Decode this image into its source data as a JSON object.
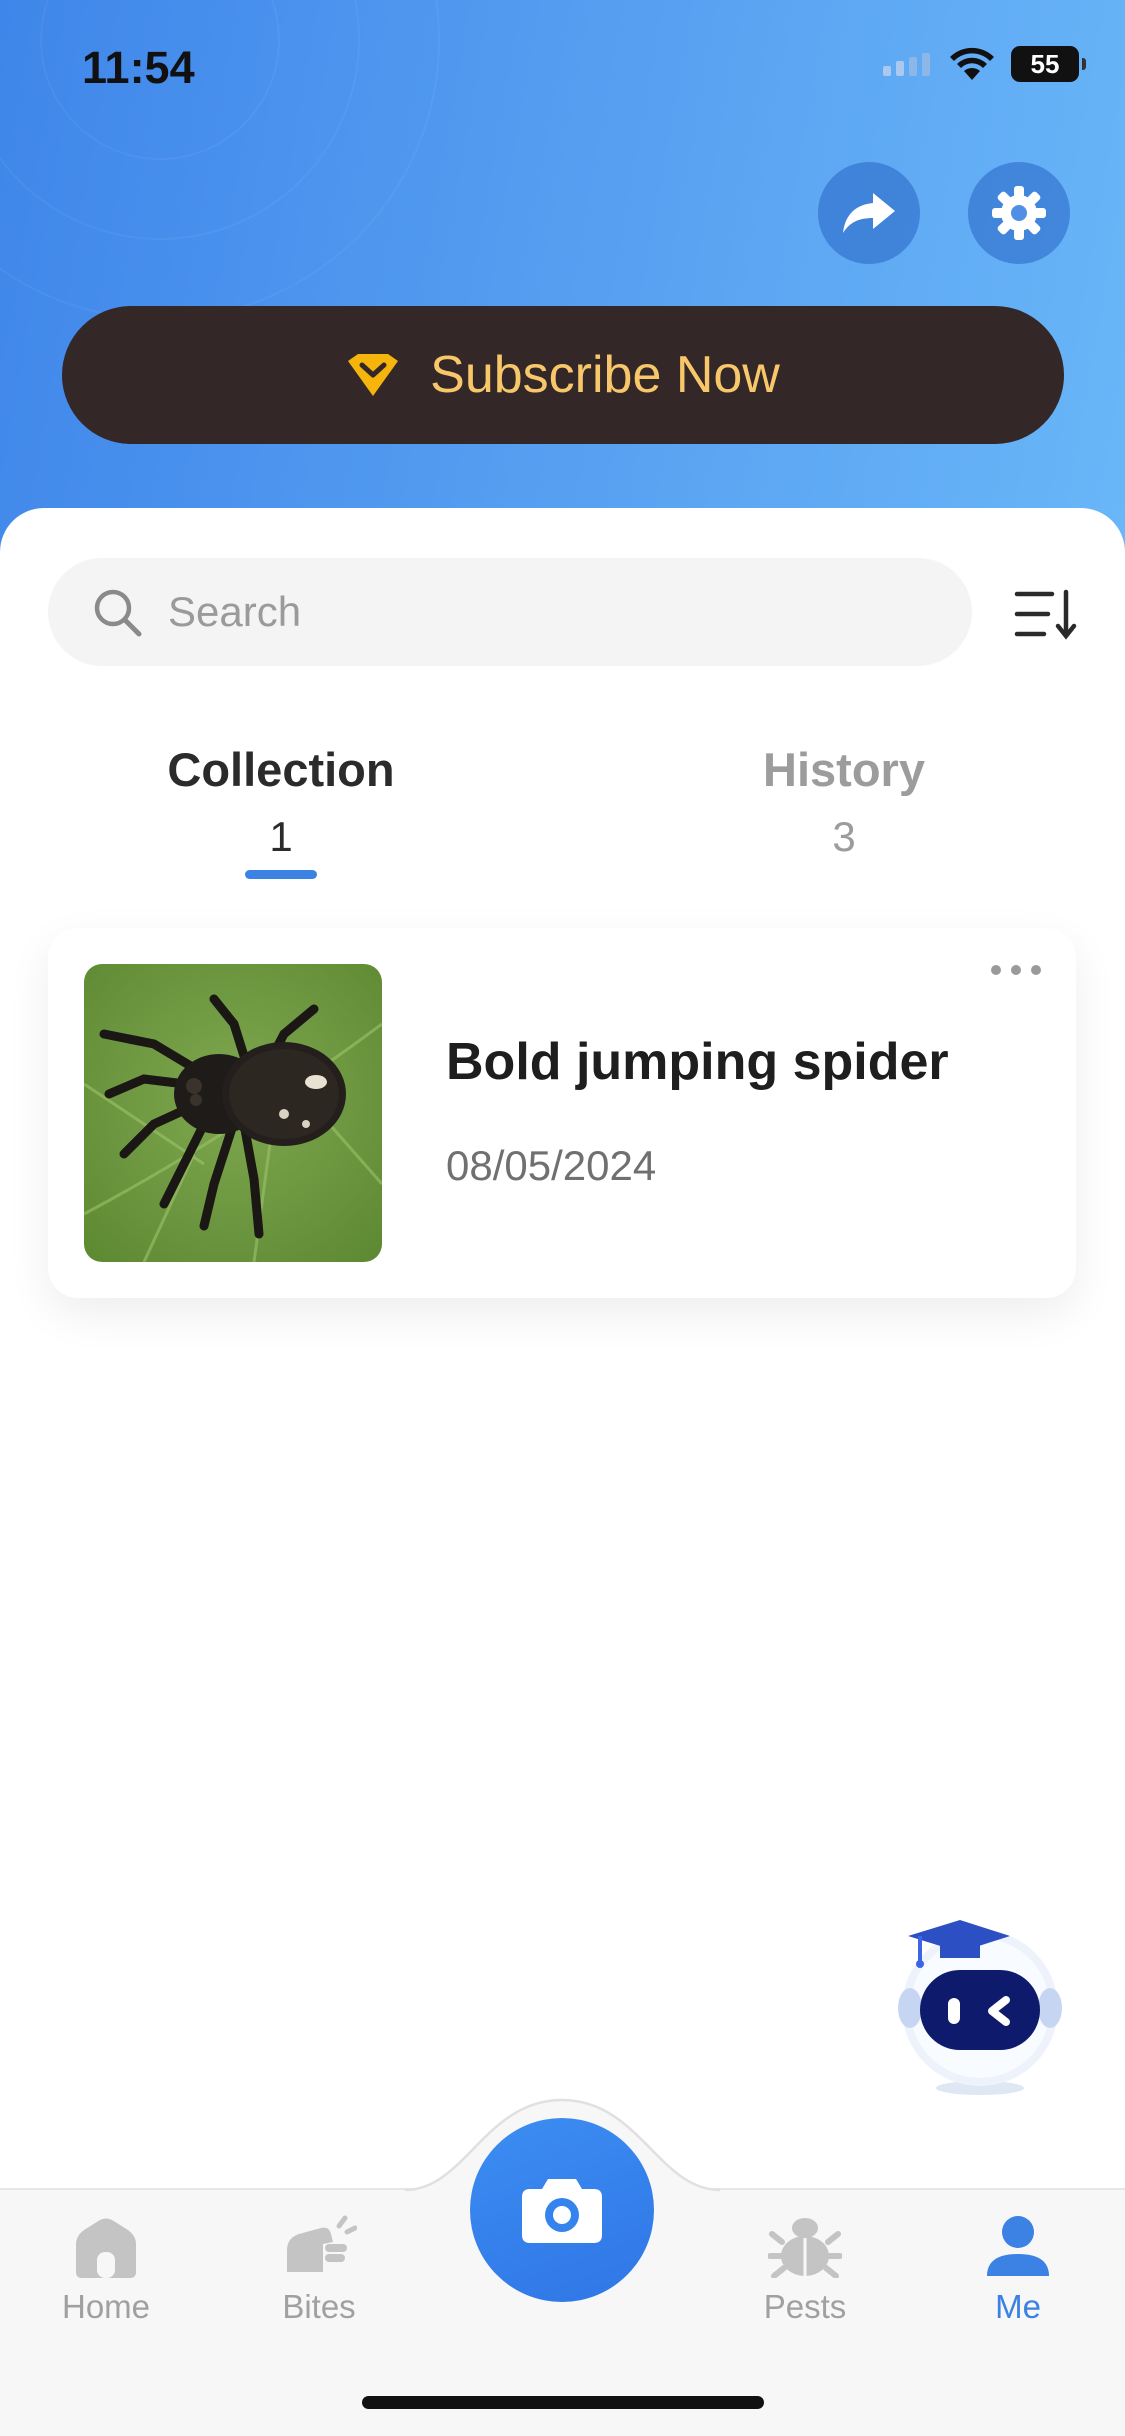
{
  "status_bar": {
    "time": "11:54",
    "battery": "55",
    "icons": [
      "signal-icon",
      "wifi-icon",
      "battery-icon"
    ]
  },
  "header": {
    "share_icon": "share-icon",
    "settings_icon": "gear-icon",
    "subscribe_label": "Subscribe Now",
    "subscribe_icon": "diamond-icon",
    "accent_color": "#f7c76a",
    "background_colors": [
      "#3f86ea",
      "#69b6f8"
    ]
  },
  "search": {
    "placeholder": "Search",
    "icon": "search-icon",
    "sort_icon": "sort-icon"
  },
  "tabs": [
    {
      "label": "Collection",
      "count": "1",
      "active": true
    },
    {
      "label": "History",
      "count": "3",
      "active": false
    }
  ],
  "collection": [
    {
      "title": "Bold jumping spider",
      "date": "08/05/2024",
      "thumbnail": "spider-photo",
      "menu_icon": "more-dots-icon"
    }
  ],
  "assistant": {
    "icon": "robot-assistant-icon"
  },
  "bottom_nav": {
    "items": [
      {
        "label": "Home",
        "icon": "home-icon",
        "active": false
      },
      {
        "label": "Bites",
        "icon": "bites-icon",
        "active": false
      },
      {
        "label": "Pests",
        "icon": "bug-icon",
        "active": false
      },
      {
        "label": "Me",
        "icon": "user-icon",
        "active": true
      }
    ],
    "camera_icon": "camera-icon",
    "active_color": "#3b82e4"
  }
}
